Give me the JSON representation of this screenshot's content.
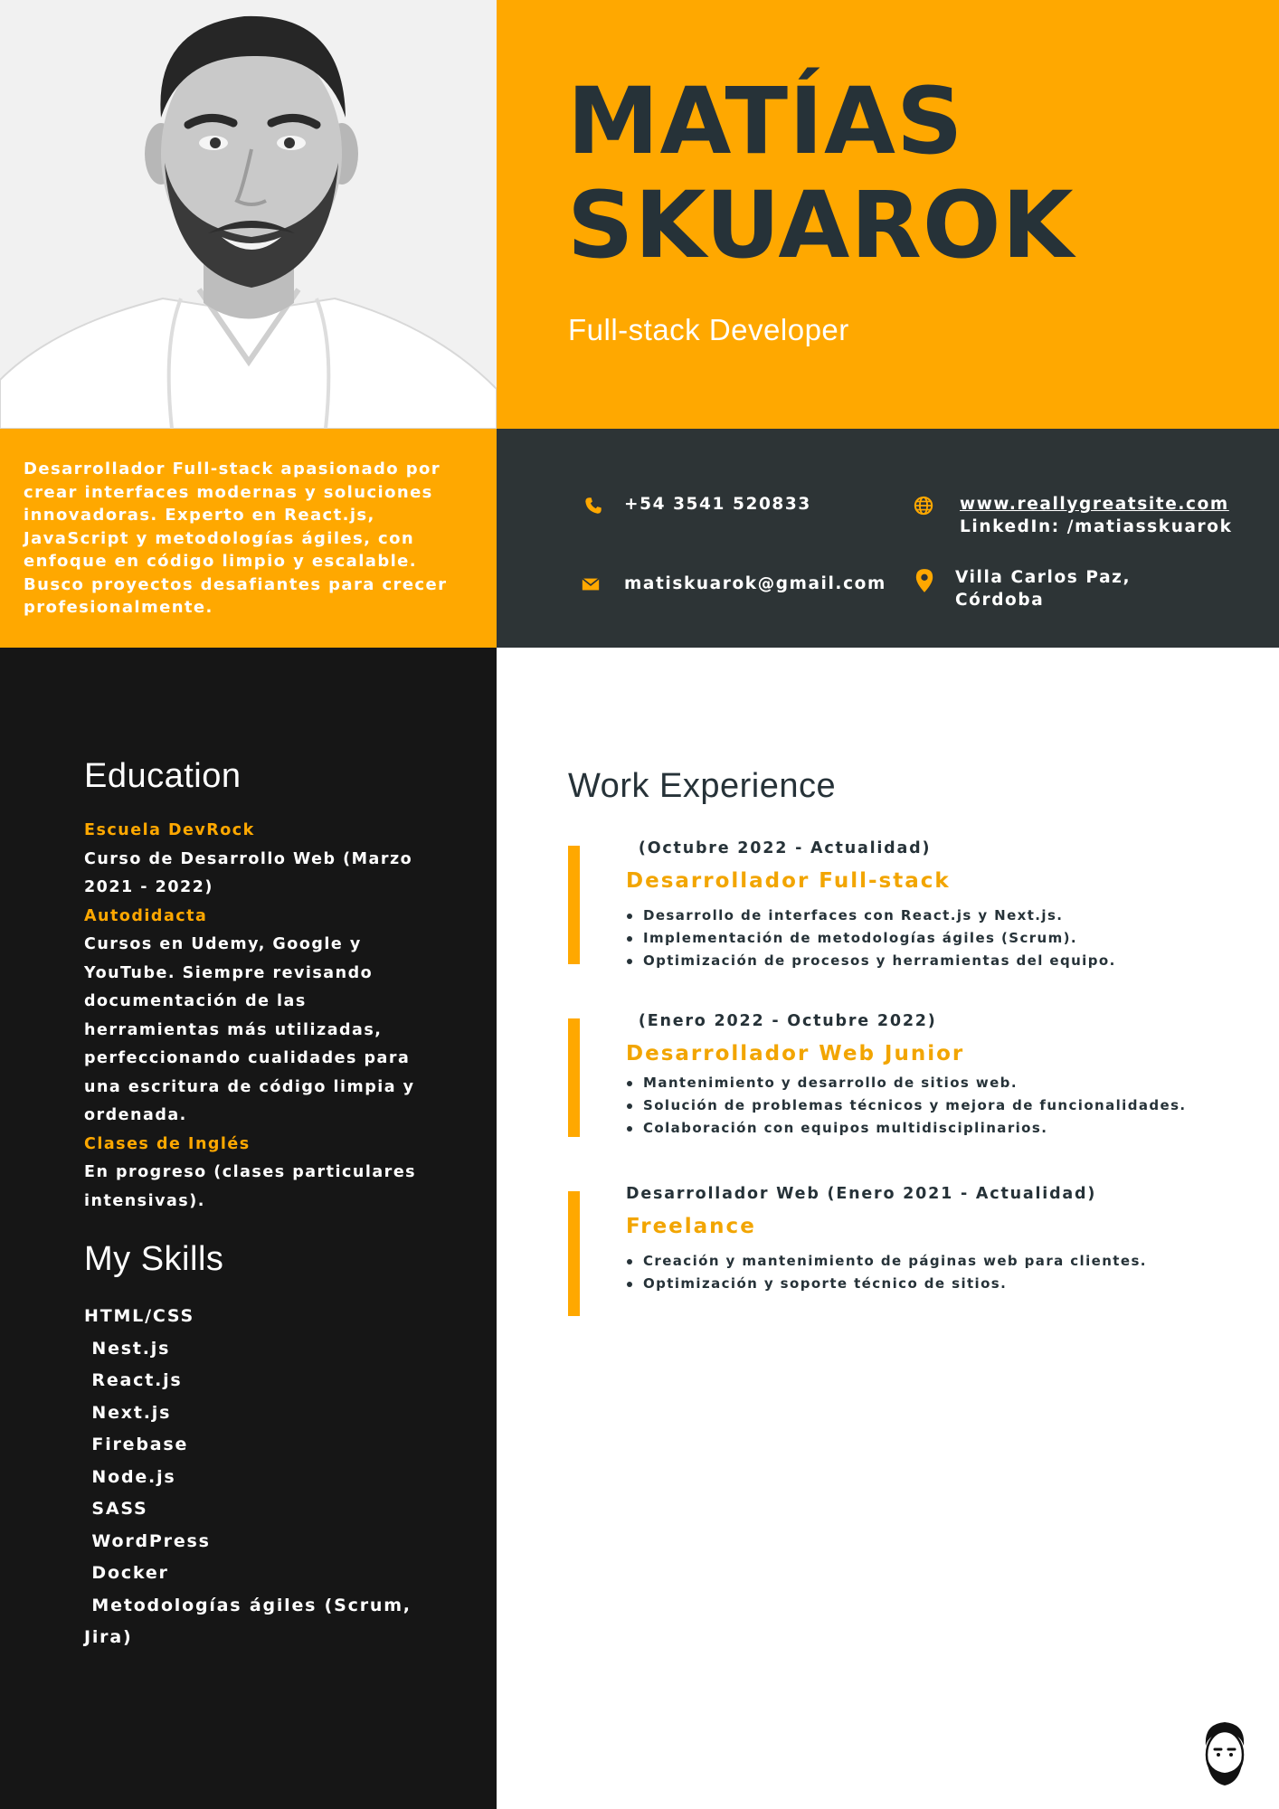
{
  "profile": {
    "first_name": "MATÍAS",
    "last_name": "SKUAROK",
    "job_title": "Full-stack Developer"
  },
  "summary": "Desarrollador Full-stack apasionado por crear interfaces modernas y soluciones innovadoras. Experto en React.js, JavaScript y metodologías ágiles, con enfoque en código limpio y escalable. Busco proyectos desafiantes para crecer profesionalmente.",
  "contact": {
    "phone": "+54 3541 520833",
    "email": "matiskuarok@gmail.com",
    "website": "www.reallygreatsite.com",
    "linkedin": "LinkedIn: /matiasskuarok",
    "location_line1": "Villa Carlos Paz,",
    "location_line2": "Córdoba",
    "icons": [
      "phone-icon",
      "mail-icon",
      "globe-icon",
      "location-pin-icon"
    ]
  },
  "education": {
    "title": "Education",
    "items": [
      {
        "school": "Escuela DevRock",
        "description": "Curso de Desarrollo Web (Marzo 2021 - 2022)"
      },
      {
        "school": "Autodidacta",
        "description": "Cursos en Udemy, Google y YouTube. Siempre revisando documentación de las herramientas más utilizadas, perfeccionando cualidades para una escritura de código limpia y ordenada."
      },
      {
        "school": "Clases de Inglés",
        "description": "En progreso (clases particulares intensivas)."
      }
    ]
  },
  "skills": {
    "title": "My Skills",
    "items": [
      "HTML/CSS",
      " Nest.js",
      " React.js",
      " Next.js",
      " Firebase",
      " Node.js",
      " SASS",
      " WordPress",
      " Docker",
      " Metodologías ágiles (Scrum, Jira)"
    ]
  },
  "work": {
    "title": "Work Experience",
    "jobs": [
      {
        "period": " (Octubre 2022 - Actualidad)",
        "role": "Desarrollador Full-stack",
        "bullets": [
          "Desarrollo de interfaces con React.js y Next.js.",
          "Implementación de metodologías ágiles (Scrum).",
          "Optimización de procesos y herramientas del equipo."
        ]
      },
      {
        "period": " (Enero 2022 - Octubre 2022)",
        "role": "Desarrollador Web Junior",
        "bullets": [
          "Mantenimiento y desarrollo de sitios web.",
          "Solución de problemas técnicos y mejora de funcionalidades.",
          "Colaboración con equipos multidisciplinarios."
        ]
      },
      {
        "period": "Desarrollador Web (Enero 2021 - Actualidad)",
        "role": "Freelance",
        "bullets": [
          "Creación y mantenimiento de páginas web para clientes.",
          "Optimización y soporte técnico de sitios."
        ]
      }
    ]
  },
  "colors": {
    "accent": "#ffa800",
    "dark": "#2d3436",
    "sidebar": "#161616",
    "heading": "#263238"
  }
}
